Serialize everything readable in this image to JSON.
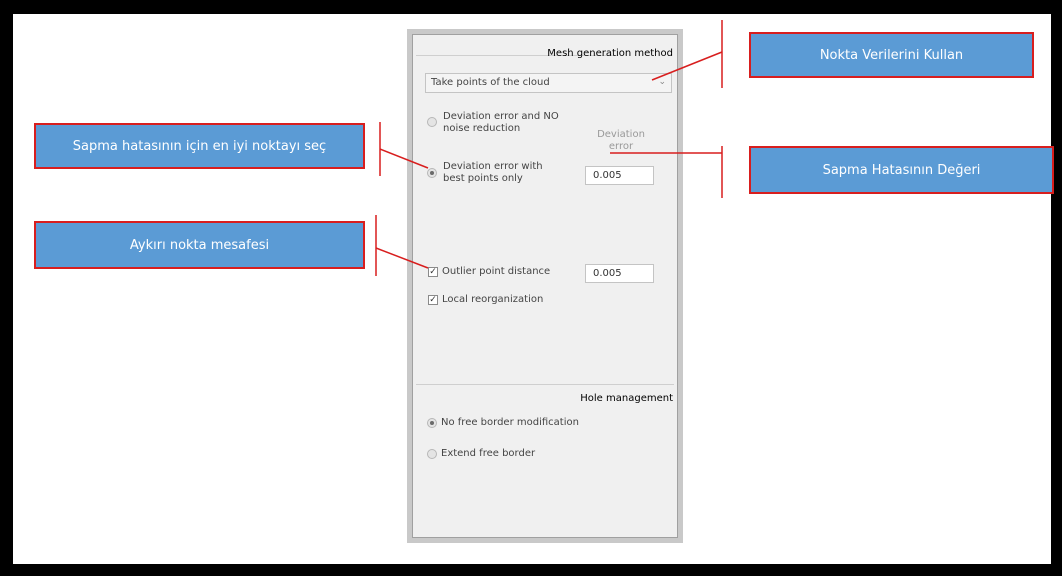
{
  "panel": {
    "mesh_section_title": "Mesh generation method",
    "dropdown_value": "Take points of the cloud",
    "option_no_noise_line1": "Deviation error and NO",
    "option_no_noise_line2": "noise reduction",
    "deviation_label_line1": "Deviation",
    "deviation_label_line2": "error",
    "option_best_points_line1": "Deviation error with",
    "option_best_points_line2": "best points only",
    "deviation_value": "0.005",
    "outlier_label": "Outlier point distance",
    "outlier_value": "0.005",
    "local_reorg_label": "Local reorganization",
    "hole_section_title": "Hole management",
    "no_free_border_label": "No free border modification",
    "extend_free_border_label": "Extend free border"
  },
  "callouts": {
    "use_point_data": "Nokta Verilerini Kullan",
    "best_point": "Sapma hatasının için en iyi noktayı seç",
    "deviation_value": "Sapma Hatasının Değeri",
    "outlier_distance": "Aykırı nokta mesafesi"
  },
  "colors": {
    "callout_fill": "#5b9bd5",
    "callout_border": "#d81e1e",
    "leader_line": "#d81e1e"
  },
  "icons": {
    "dropdown": "chevron-down-icon"
  }
}
